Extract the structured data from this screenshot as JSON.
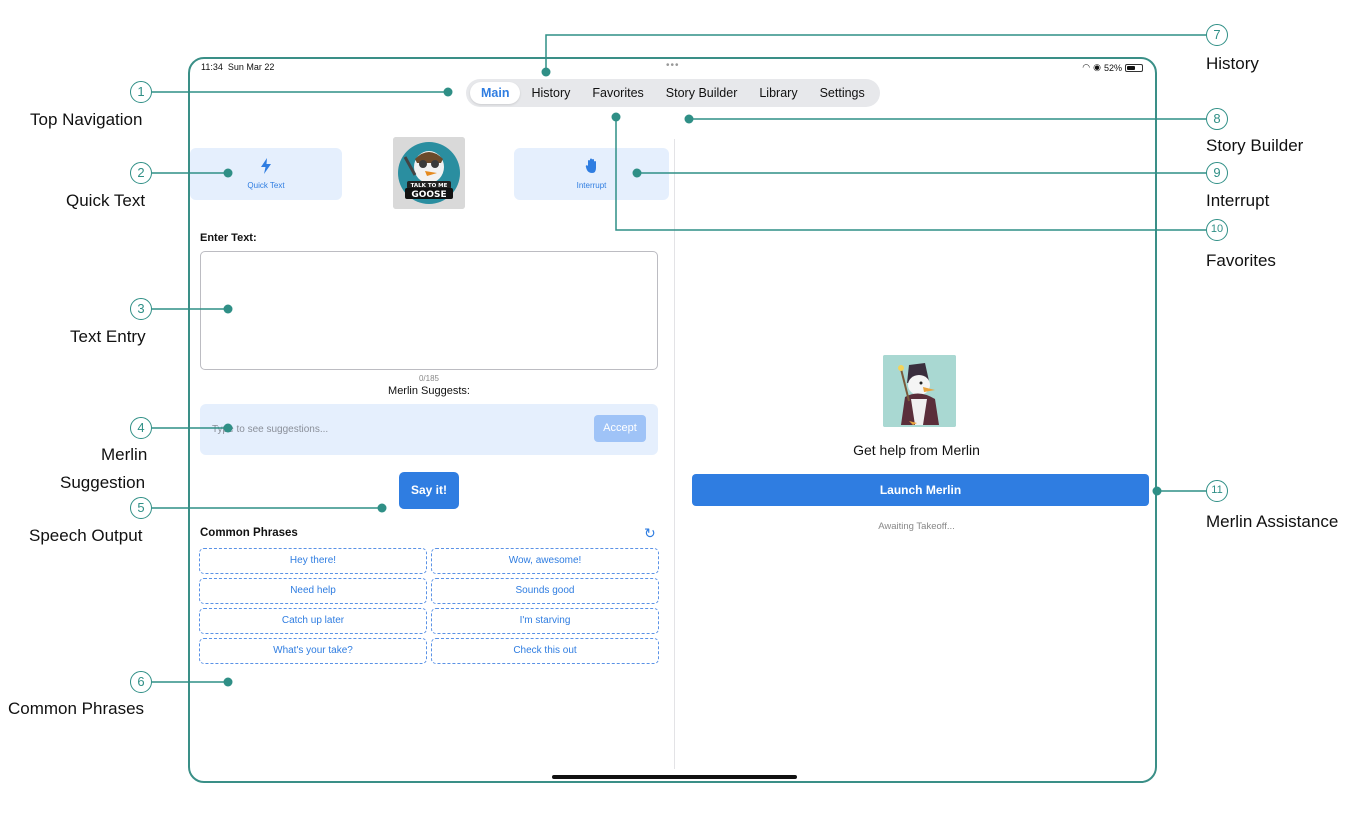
{
  "status_bar": {
    "time": "11:34",
    "date": "Sun Mar 22",
    "battery": "52%"
  },
  "nav_tabs": [
    "Main",
    "History",
    "Favorites",
    "Story Builder",
    "Library",
    "Settings"
  ],
  "active_tab": "Main",
  "quick_text": {
    "label": "Quick Text"
  },
  "interrupt": {
    "label": "Interrupt"
  },
  "logo": {
    "top_text": "TALK TO ME",
    "bottom_text": "GOOSE"
  },
  "text_entry": {
    "label": "Enter Text:",
    "value": "",
    "counter": "0/185"
  },
  "merlin_suggest": {
    "label": "Merlin Suggests:",
    "placeholder": "Type to see suggestions...",
    "accept_label": "Accept"
  },
  "say_it": {
    "label": "Say it!"
  },
  "common_phrases": {
    "title": "Common Phrases",
    "items": [
      "Hey there!",
      "Wow, awesome!",
      "Need help",
      "Sounds good",
      "Catch up later",
      "I'm starving",
      "What's your take?",
      "Check this out"
    ]
  },
  "merlin_panel": {
    "help_text": "Get help from Merlin",
    "launch_label": "Launch Merlin",
    "status": "Awaiting Takeoff..."
  },
  "callouts": {
    "c1": {
      "number": "1",
      "label": "Top Navigation"
    },
    "c2": {
      "number": "2",
      "label": "Quick Text"
    },
    "c3": {
      "number": "3",
      "label": "Text Entry"
    },
    "c4": {
      "number": "4",
      "label_line1": "Merlin",
      "label_line2": "Suggestion"
    },
    "c5": {
      "number": "5",
      "label": "Speech Output"
    },
    "c6": {
      "number": "6",
      "label": "Common Phrases"
    },
    "c7": {
      "number": "7",
      "label": "History"
    },
    "c8": {
      "number": "8",
      "label": "Story Builder"
    },
    "c9": {
      "number": "9",
      "label": "Interrupt"
    },
    "c10": {
      "number": "10",
      "label": "Favorites"
    },
    "c11": {
      "number": "11",
      "label": "Merlin Assistance"
    }
  },
  "colors": {
    "accent": "#2f7de1",
    "callout": "#2f8f86",
    "light_blue": "#e5effd"
  }
}
